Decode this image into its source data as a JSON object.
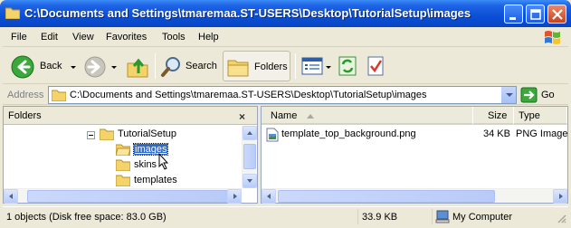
{
  "window": {
    "title": "C:\\Documents and Settings\\tmaremaa.ST-USERS\\Desktop\\TutorialSetup\\images",
    "titlebar_color": "#0a4fd6"
  },
  "menu": {
    "items": [
      "File",
      "Edit",
      "View",
      "Favorites",
      "Tools",
      "Help"
    ]
  },
  "toolbar": {
    "back_label": "Back",
    "search_label": "Search",
    "folders_label": "Folders"
  },
  "address": {
    "label": "Address",
    "value": "C:\\Documents and Settings\\tmaremaa.ST-USERS\\Desktop\\TutorialSetup\\images",
    "go_label": "Go"
  },
  "folders_pane": {
    "title": "Folders",
    "close_glyph": "×",
    "tree": [
      {
        "label": "TutorialSetup",
        "expanded": true
      },
      {
        "label": "images",
        "selected": true
      },
      {
        "label": "skins"
      },
      {
        "label": "templates"
      }
    ]
  },
  "files_pane": {
    "columns": [
      "Name",
      "Size",
      "Type"
    ],
    "rows": [
      {
        "name": "template_top_background.png",
        "size": "34 KB",
        "type": "PNG Image"
      }
    ]
  },
  "status": {
    "summary": "1 objects (Disk free space: 83.0 GB)",
    "size": "33.9 KB",
    "location": "My Computer"
  }
}
